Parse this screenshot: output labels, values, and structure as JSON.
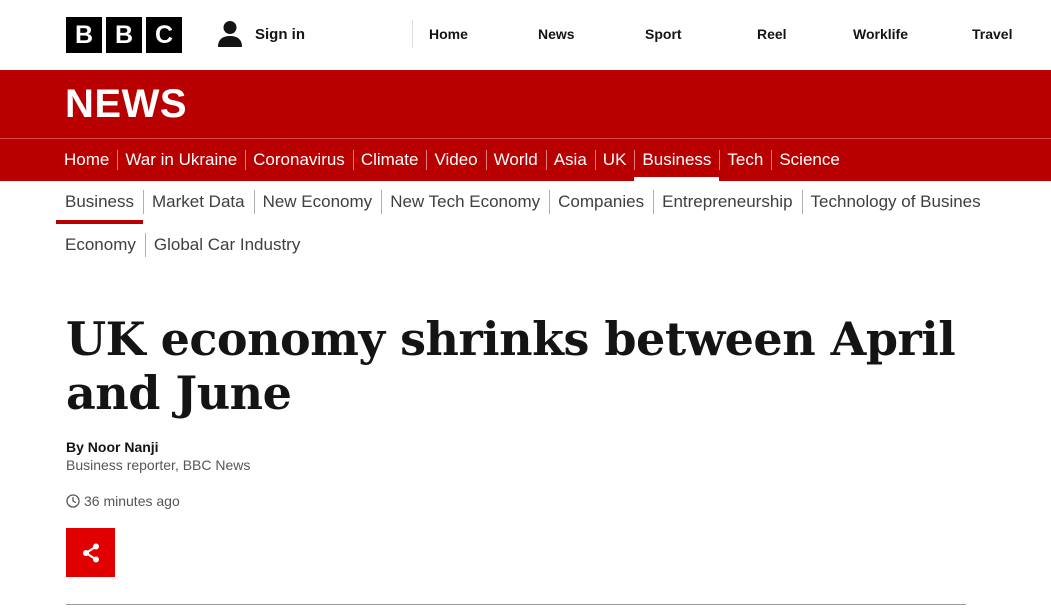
{
  "masthead": {
    "logo_letters": [
      "B",
      "B",
      "C"
    ],
    "sign_in_label": "Sign in",
    "sign_in_icon": "user-icon",
    "nav": [
      "Home",
      "News",
      "Sport",
      "Reel",
      "Worklife",
      "Travel"
    ]
  },
  "news_banner": {
    "wordmark": "NEWS",
    "background_color": "#b80000",
    "primary_nav": [
      {
        "label": "Home",
        "active": false
      },
      {
        "label": "War in Ukraine",
        "active": false
      },
      {
        "label": "Coronavirus",
        "active": false
      },
      {
        "label": "Climate",
        "active": false
      },
      {
        "label": "Video",
        "active": false
      },
      {
        "label": "World",
        "active": false
      },
      {
        "label": "Asia",
        "active": false
      },
      {
        "label": "UK",
        "active": false
      },
      {
        "label": "Business",
        "active": true
      },
      {
        "label": "Tech",
        "active": false
      },
      {
        "label": "Science",
        "active": false
      }
    ]
  },
  "secondary_nav": {
    "row1": [
      {
        "label": "Business",
        "active": true
      },
      {
        "label": "Market Data",
        "active": false
      },
      {
        "label": "New Economy",
        "active": false
      },
      {
        "label": "New Tech Economy",
        "active": false
      },
      {
        "label": "Companies",
        "active": false
      },
      {
        "label": "Entrepreneurship",
        "active": false
      },
      {
        "label": "Technology of Busines",
        "active": false
      }
    ],
    "row2": [
      {
        "label": "Economy",
        "active": false
      },
      {
        "label": "Global Car Industry",
        "active": false
      }
    ]
  },
  "article": {
    "headline": "UK economy shrinks between April and June",
    "byline_author": "By Noor Nanji",
    "byline_role": "Business reporter, BBC News",
    "timestamp": "36 minutes ago",
    "timestamp_icon": "clock-icon",
    "share_icon": "share-icon",
    "share_color": "#e00000"
  }
}
